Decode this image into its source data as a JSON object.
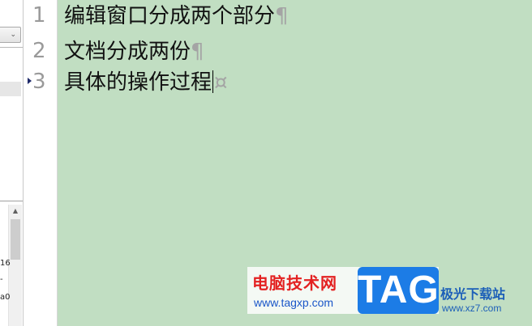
{
  "side_panel": {
    "dropdown_arrow": "⌄",
    "scroll_up_arrow": "▲",
    "fragments": [
      "16",
      "-",
      "a0"
    ]
  },
  "editor": {
    "line_numbers": [
      "1",
      "2",
      "3"
    ],
    "lines": [
      {
        "text": "编辑窗口分成两个部分",
        "end_mark": "¶"
      },
      {
        "text": "文档分成两份",
        "end_mark": "¶"
      },
      {
        "text": "具体的操作过程",
        "end_mark": "¤"
      }
    ],
    "current_line": 3,
    "background_color": "#c1dec2"
  },
  "watermark": {
    "title": "电脑技术网",
    "url": "www.tagxp.com",
    "tag": "TAG",
    "site_name": "极光下载站",
    "site_url": "www.xz7.com"
  }
}
